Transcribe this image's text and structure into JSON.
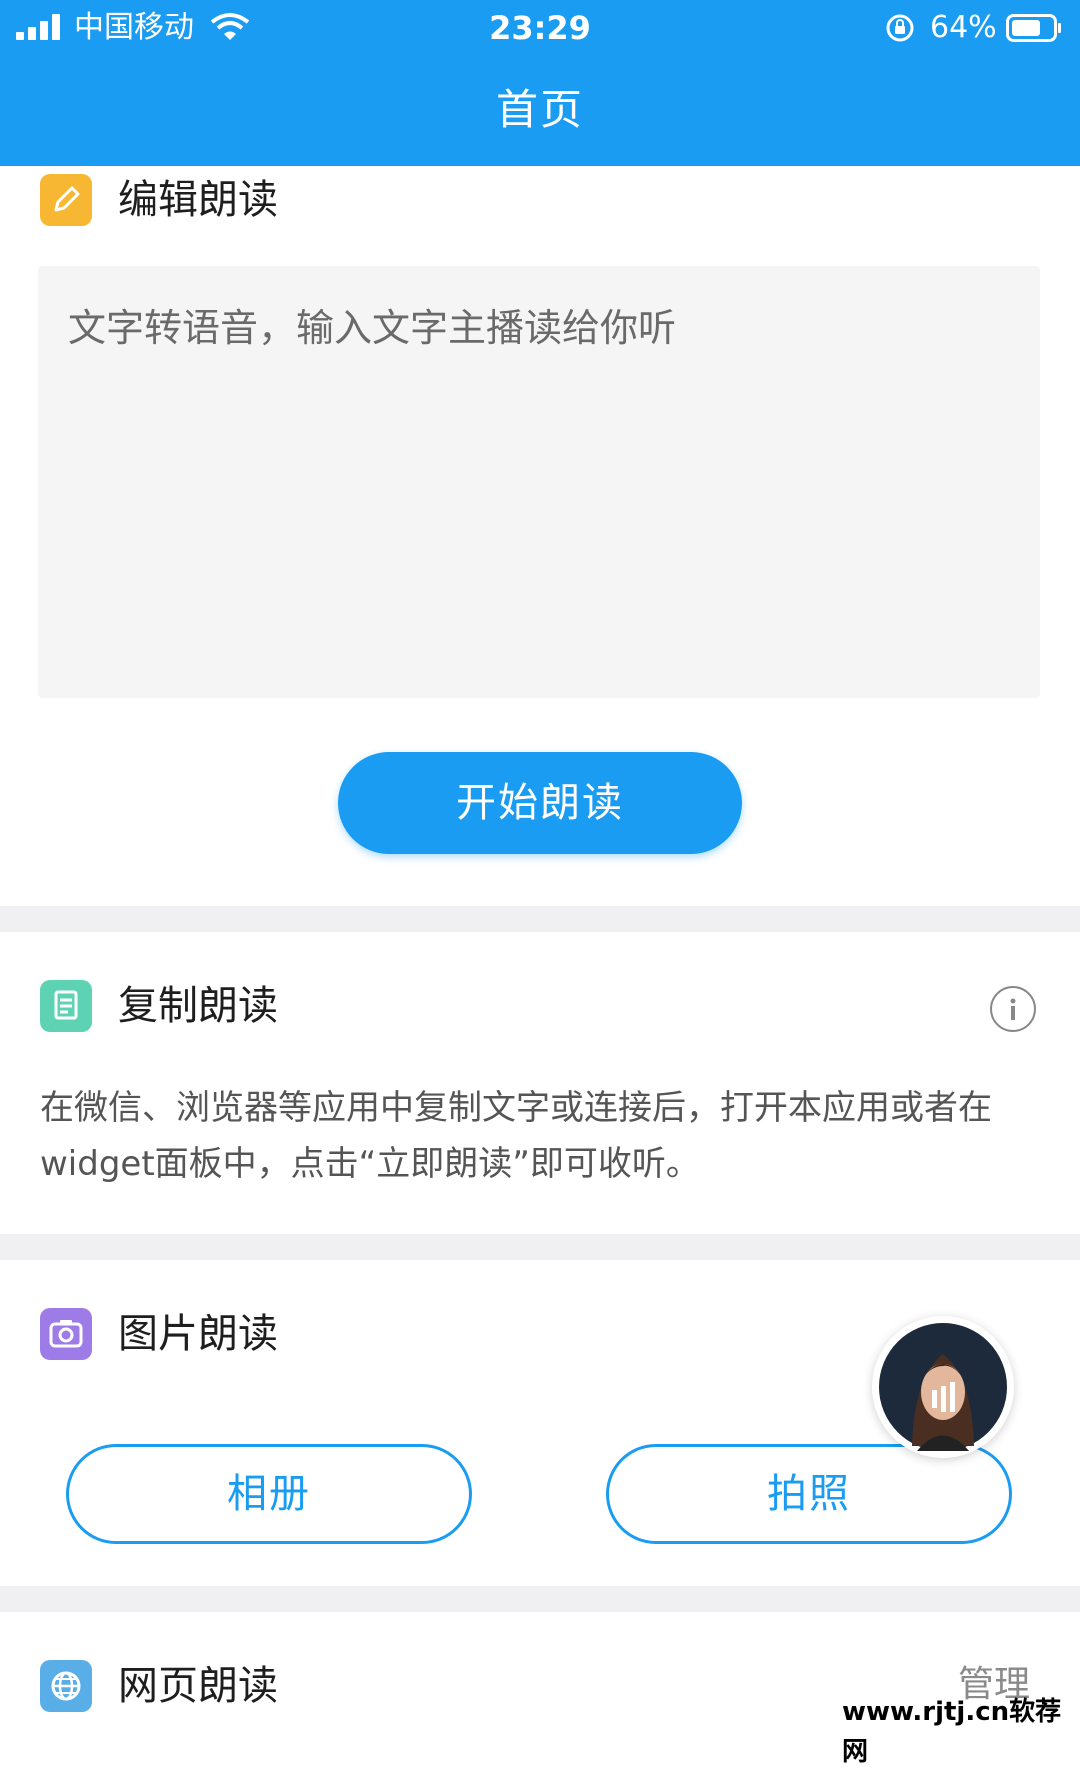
{
  "status_bar": {
    "carrier": "中国移动",
    "time": "23:29",
    "battery": "64%"
  },
  "nav": {
    "title": "首页"
  },
  "edit_section": {
    "title": "编辑朗读",
    "placeholder": "文字转语音，输入文字主播读给你听",
    "button": "开始朗读"
  },
  "copy_section": {
    "title": "复制朗读",
    "description": "在微信、浏览器等应用中复制文字或连接后，打开本应用或者在widget面板中，点击“立即朗读”即可收听。"
  },
  "image_section": {
    "title": "图片朗读",
    "album_button": "相册",
    "camera_button": "拍照"
  },
  "web_section": {
    "title": "网页朗读",
    "manage": "管理"
  },
  "watermark": "www.rjtj.cn软荐网",
  "colors": {
    "primary": "#1a9cf2",
    "edit_icon": "#f7b733",
    "copy_icon": "#5ed3b4",
    "image_icon": "#9d7ce8",
    "web_icon": "#5aaee8"
  },
  "icons": {
    "edit": "pencil-icon",
    "copy": "document-icon",
    "image": "camera-icon",
    "web": "globe-icon",
    "info": "info-icon"
  }
}
